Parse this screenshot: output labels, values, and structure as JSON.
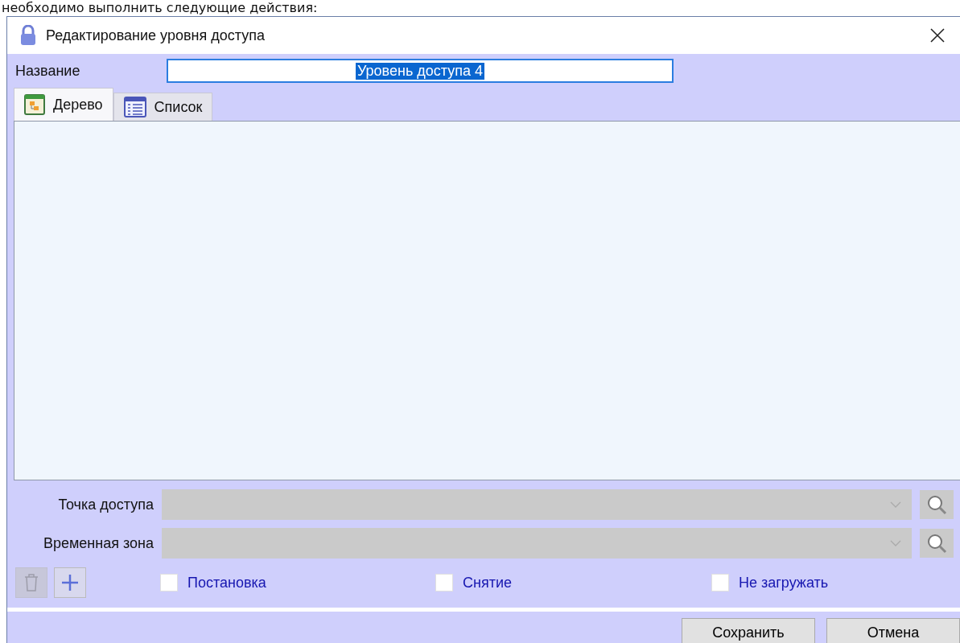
{
  "page_text": "необходимо выполнить следующие действия:",
  "window": {
    "title": "Редактирование уровня доступа"
  },
  "name_field": {
    "label": "Название",
    "value": "Уровень доступа 4"
  },
  "tabs": [
    {
      "label": "Дерево",
      "kind": "tree",
      "selected": true
    },
    {
      "label": "Список",
      "kind": "list",
      "selected": false
    }
  ],
  "fields": [
    {
      "label": "Точка доступа",
      "disabled": true
    },
    {
      "label": "Временная зона",
      "disabled": true
    }
  ],
  "delete_button": {
    "disabled": true
  },
  "checkboxes": [
    {
      "label": "Постановка",
      "checked": false
    },
    {
      "label": "Снятие",
      "checked": false
    },
    {
      "label": "Не загружать",
      "checked": false
    }
  ],
  "buttons": [
    "Сохранить",
    "Отмена"
  ]
}
